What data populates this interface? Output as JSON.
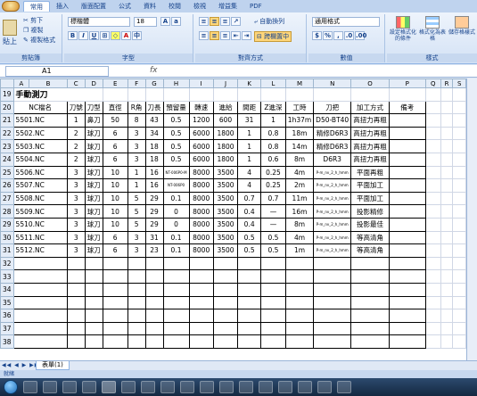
{
  "ribbon": {
    "tabs": [
      "常用",
      "插入",
      "版面配置",
      "公式",
      "資料",
      "校閱",
      "檢視",
      "增益集",
      "PDF"
    ],
    "clipboard": {
      "paste": "貼上",
      "cut": "剪下",
      "copy": "複製",
      "format_painter": "複製格式",
      "label": "剪貼簿"
    },
    "font": {
      "name": "標楷體",
      "size": "18",
      "label": "字型"
    },
    "alignment": {
      "wrap": "自動換列",
      "merge": "跨欄置中",
      "label": "對齊方式"
    },
    "number": {
      "format": "通用格式",
      "label": "數值"
    },
    "styles": {
      "conditional": "設定格式化的條件",
      "as_table": "格式化為表格",
      "cell_styles": "儲存格樣式",
      "label": "樣式"
    }
  },
  "formula_bar": {
    "cell_ref": "A1",
    "fx": "fx"
  },
  "columns": [
    "A",
    "B",
    "C",
    "D",
    "E",
    "F",
    "G",
    "H",
    "I",
    "J",
    "K",
    "L",
    "M",
    "N",
    "O",
    "P",
    "Q",
    "R",
    "S"
  ],
  "sheet": {
    "title_row": "19",
    "title": "手動測刀",
    "header_row": "20",
    "headers": [
      "NC檔名",
      "刀號",
      "刀型",
      "直徑",
      "R角",
      "刀長",
      "預留量",
      "轉速",
      "進給",
      "間距",
      "Z進深",
      "工時",
      "刀把",
      "加工方式",
      "備考"
    ],
    "rows": [
      {
        "num": "21",
        "cells": [
          "5501.NC",
          "1",
          "鼻刀",
          "50",
          "8",
          "43",
          "0.5",
          "1200",
          "600",
          "31",
          "1",
          "1h37m",
          "D50-BT40",
          "高扭力再粗",
          ""
        ]
      },
      {
        "num": "22",
        "cells": [
          "5502.NC",
          "2",
          "球刀",
          "6",
          "3",
          "34",
          "0.5",
          "6000",
          "1800",
          "1",
          "0.8",
          "18m",
          "精修D6R3",
          "高扭力再粗",
          ""
        ]
      },
      {
        "num": "23",
        "cells": [
          "5503.NC",
          "2",
          "球刀",
          "6",
          "3",
          "18",
          "0.5",
          "6000",
          "1800",
          "1",
          "0.8",
          "14m",
          "精修D6R3",
          "高扭力再粗",
          ""
        ]
      },
      {
        "num": "24",
        "cells": [
          "5504.NC",
          "2",
          "球刀",
          "6",
          "3",
          "18",
          "0.5",
          "6000",
          "1800",
          "1",
          "0.6",
          "8m",
          "D6R3",
          "高扭力再粗",
          ""
        ]
      },
      {
        "num": "25",
        "cells": [
          "5506.NC",
          "3",
          "球刀",
          "10",
          "1",
          "16",
          "NT-006P0-M",
          "8000",
          "3500",
          "4",
          "0.25",
          "4m",
          "P-m_nv_2_h_hmm",
          "平面再粗",
          ""
        ]
      },
      {
        "num": "26",
        "cells": [
          "5507.NC",
          "3",
          "球刀",
          "10",
          "1",
          "16",
          "NT-006P0",
          "8000",
          "3500",
          "4",
          "0.25",
          "2m",
          "P-m_nv_2_h_hmm",
          "平面加工",
          ""
        ]
      },
      {
        "num": "27",
        "cells": [
          "5508.NC",
          "3",
          "球刀",
          "10",
          "5",
          "29",
          "0.1",
          "8000",
          "3500",
          "0.7",
          "0.7",
          "11m",
          "P-m_nv_2_h_hmm",
          "平面加工",
          ""
        ]
      },
      {
        "num": "28",
        "cells": [
          "5509.NC",
          "3",
          "球刀",
          "10",
          "5",
          "29",
          "0",
          "8000",
          "3500",
          "0.4",
          "—",
          "16m",
          "P-m_nv_2_h_hmm",
          "投影精修",
          ""
        ]
      },
      {
        "num": "29",
        "cells": [
          "5510.NC",
          "3",
          "球刀",
          "10",
          "5",
          "29",
          "0",
          "8000",
          "3500",
          "0.4",
          "—",
          "8m",
          "P-m_nv_2_h_hmm",
          "投影最佳",
          ""
        ]
      },
      {
        "num": "30",
        "cells": [
          "5511.NC",
          "3",
          "球刀",
          "6",
          "3",
          "31",
          "0.1",
          "8000",
          "3500",
          "0.5",
          "0.5",
          "4m",
          "P-m_nv_2_h_hmm",
          "等高清角",
          ""
        ]
      },
      {
        "num": "31",
        "cells": [
          "5512.NC",
          "3",
          "球刀",
          "6",
          "3",
          "23",
          "0.1",
          "8000",
          "3500",
          "0.5",
          "0.5",
          "1m",
          "P-m_nv_2_h_hmm",
          "等高清角",
          ""
        ]
      }
    ],
    "empty_rows": [
      "32",
      "33",
      "34",
      "35",
      "36",
      "37",
      "38"
    ]
  },
  "tabs_bar": {
    "sheet_tab": "表單(1)",
    "status": "就緒"
  },
  "colors": {
    "ribbon_bg": "#dfe8f5",
    "accent": "#15428b",
    "grid_line": "#d0d7e5",
    "header_bg": "#e4ecf7"
  }
}
